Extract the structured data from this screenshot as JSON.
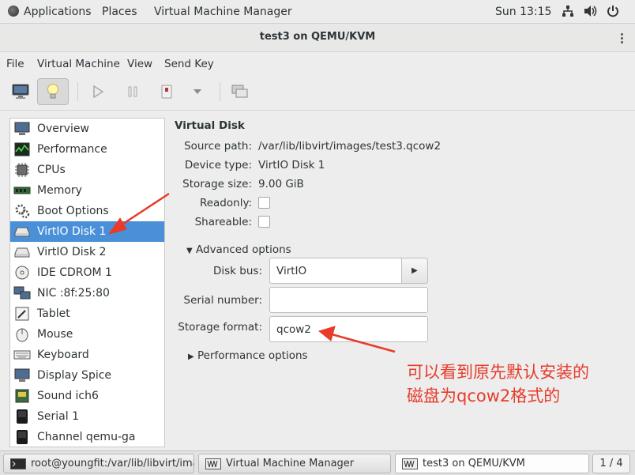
{
  "topbar": {
    "applications": "Applications",
    "places": "Places",
    "app_name": "Virtual Machine Manager",
    "clock": "Sun 13:15",
    "icons": [
      "network-icon",
      "volume-icon",
      "power-icon"
    ]
  },
  "window": {
    "title": "test3 on QEMU/KVM"
  },
  "menu": {
    "items": [
      "File",
      "Virtual Machine",
      "View",
      "Send Key"
    ]
  },
  "toolbar": {
    "buttons": [
      "console-view-icon",
      "details-view-icon",
      "run-icon",
      "pause-icon",
      "shutdown-icon",
      "shutdown-menu-icon",
      "snapshots-icon"
    ]
  },
  "sidebar": {
    "items": [
      {
        "label": "Overview",
        "icon": "overview-icon"
      },
      {
        "label": "Performance",
        "icon": "performance-icon"
      },
      {
        "label": "CPUs",
        "icon": "cpu-icon"
      },
      {
        "label": "Memory",
        "icon": "memory-icon"
      },
      {
        "label": "Boot Options",
        "icon": "boot-options-icon"
      },
      {
        "label": "VirtIO Disk 1",
        "icon": "disk-icon",
        "selected": true
      },
      {
        "label": "VirtIO Disk 2",
        "icon": "disk-icon"
      },
      {
        "label": "IDE CDROM 1",
        "icon": "cdrom-icon"
      },
      {
        "label": "NIC :8f:25:80",
        "icon": "nic-icon"
      },
      {
        "label": "Tablet",
        "icon": "tablet-icon"
      },
      {
        "label": "Mouse",
        "icon": "mouse-icon"
      },
      {
        "label": "Keyboard",
        "icon": "keyboard-icon"
      },
      {
        "label": "Display Spice",
        "icon": "display-icon"
      },
      {
        "label": "Sound ich6",
        "icon": "sound-icon"
      },
      {
        "label": "Serial 1",
        "icon": "serial-icon"
      },
      {
        "label": "Channel qemu-ga",
        "icon": "channel-icon"
      }
    ]
  },
  "disk": {
    "section_title": "Virtual Disk",
    "source_path_label": "Source path:",
    "source_path": "/var/lib/libvirt/images/test3.qcow2",
    "device_type_label": "Device type:",
    "device_type": "VirtIO Disk 1",
    "storage_size_label": "Storage size:",
    "storage_size": "9.00 GiB",
    "readonly_label": "Readonly:",
    "shareable_label": "Shareable:",
    "advanced_label": "Advanced options",
    "disk_bus_label": "Disk bus:",
    "disk_bus": "VirtIO",
    "serial_label": "Serial number:",
    "serial_value": "",
    "storage_format_label": "Storage format:",
    "storage_format": "qcow2",
    "performance_label": "Performance options"
  },
  "annotation": {
    "line1": "可以看到原先默认安装的",
    "line2": "磁盘为qcow2格式的",
    "color": "#e83b2a"
  },
  "taskbar": {
    "tasks": [
      {
        "label": "root@youngfit:/var/lib/libvirt/ima...",
        "icon": "terminal-icon"
      },
      {
        "label": "Virtual Machine Manager",
        "icon": "vmm-icon"
      },
      {
        "label": "test3 on QEMU/KVM",
        "icon": "vmm-icon"
      }
    ],
    "pager": "1 / 4"
  }
}
